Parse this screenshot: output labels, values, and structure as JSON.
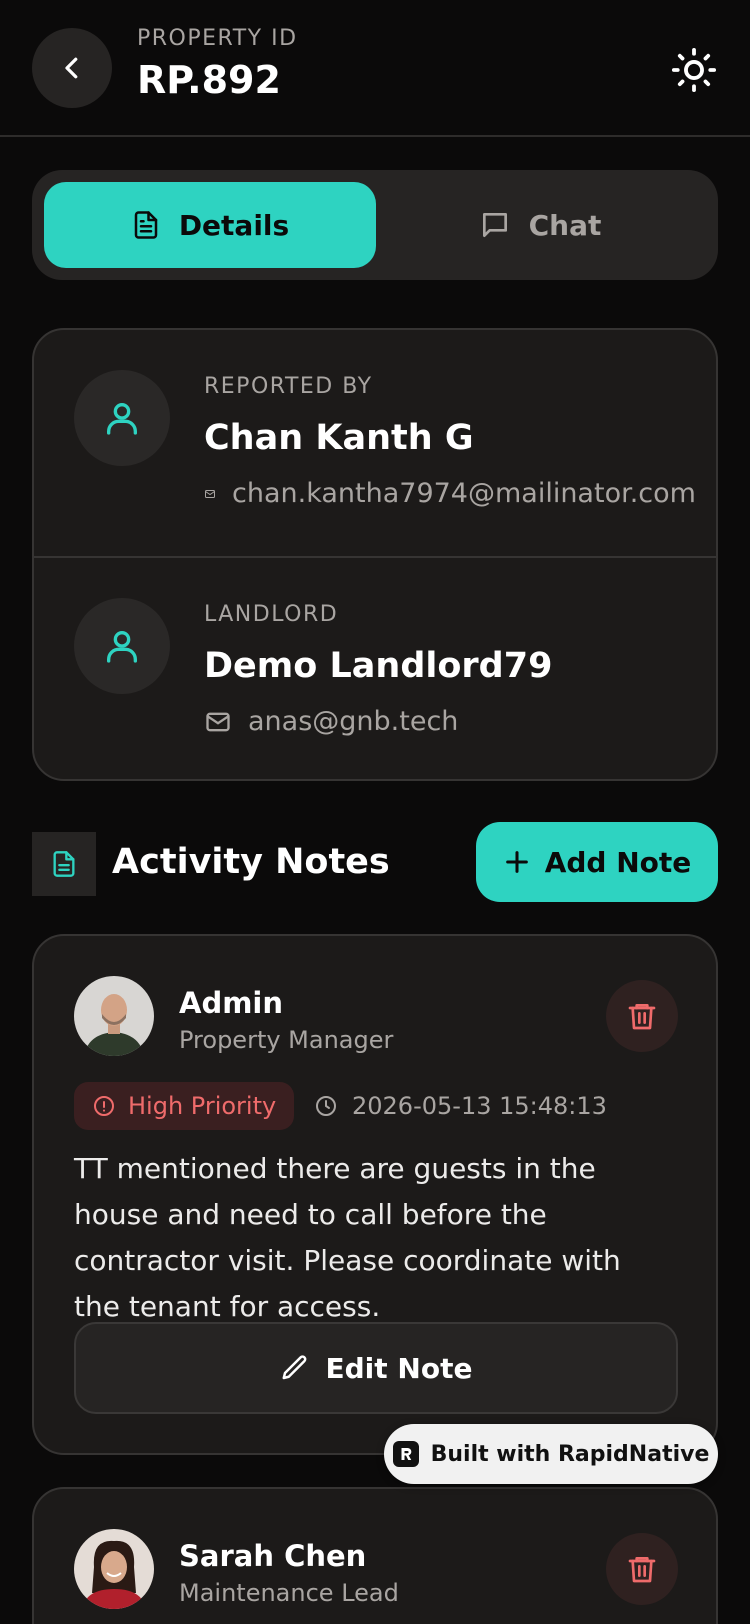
{
  "header": {
    "label": "PROPERTY ID",
    "property_id": "RP.892"
  },
  "tabs": [
    {
      "label": "Details",
      "active": true,
      "icon": "document-icon"
    },
    {
      "label": "Chat",
      "active": false,
      "icon": "chat-bubble-icon"
    }
  ],
  "people": [
    {
      "role": "REPORTED BY",
      "name": "Chan Kanth G",
      "email": "chan.kantha7974@mailinator.com"
    },
    {
      "role": "LANDLORD",
      "name": "Demo Landlord79",
      "email": "anas@gnb.tech"
    }
  ],
  "notes_section": {
    "title": "Activity Notes",
    "add_button_label": "Add Note"
  },
  "notes": [
    {
      "author": "Admin",
      "role": "Property Manager",
      "priority": "High Priority",
      "timestamp": "2026-05-13 15:48:13",
      "text": "TT mentioned there are guests in the house and need to call before the contractor visit. Please coordinate with the tenant for access.",
      "edit_label": "Edit Note"
    },
    {
      "author": "Sarah Chen",
      "role": "Maintenance Lead"
    }
  ],
  "badge": {
    "label": "Built with RapidNative"
  },
  "colors": {
    "accent": "#2ed3c1",
    "background": "#0b0a0a",
    "card": "#1c1a19",
    "danger": "#ef6b6b"
  }
}
